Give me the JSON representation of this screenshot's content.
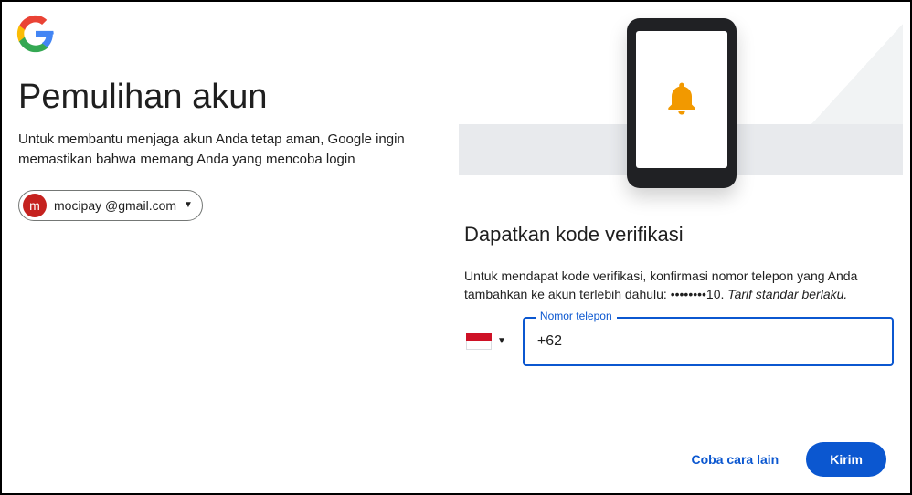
{
  "header": {
    "title": "Pemulihan akun",
    "subtitle": "Untuk membantu menjaga akun Anda tetap aman, Google ingin memastikan bahwa memang Anda yang mencoba login"
  },
  "account": {
    "avatar_initial": "m",
    "email": "mocipay      @gmail.com"
  },
  "verify": {
    "title": "Dapatkan kode verifikasi",
    "desc_prefix": "Untuk mendapat kode verifikasi, konfirmasi nomor telepon yang Anda tambahkan ke akun terlebih dahulu: ",
    "masked_number": "••••••••10",
    "desc_suffix": ". ",
    "rate_notice": "Tarif standar berlaku.",
    "phone_label": "Nomor telepon",
    "phone_value": "+62 ",
    "country_code_selected": "ID"
  },
  "actions": {
    "try_another": "Coba cara lain",
    "send": "Kirim"
  }
}
